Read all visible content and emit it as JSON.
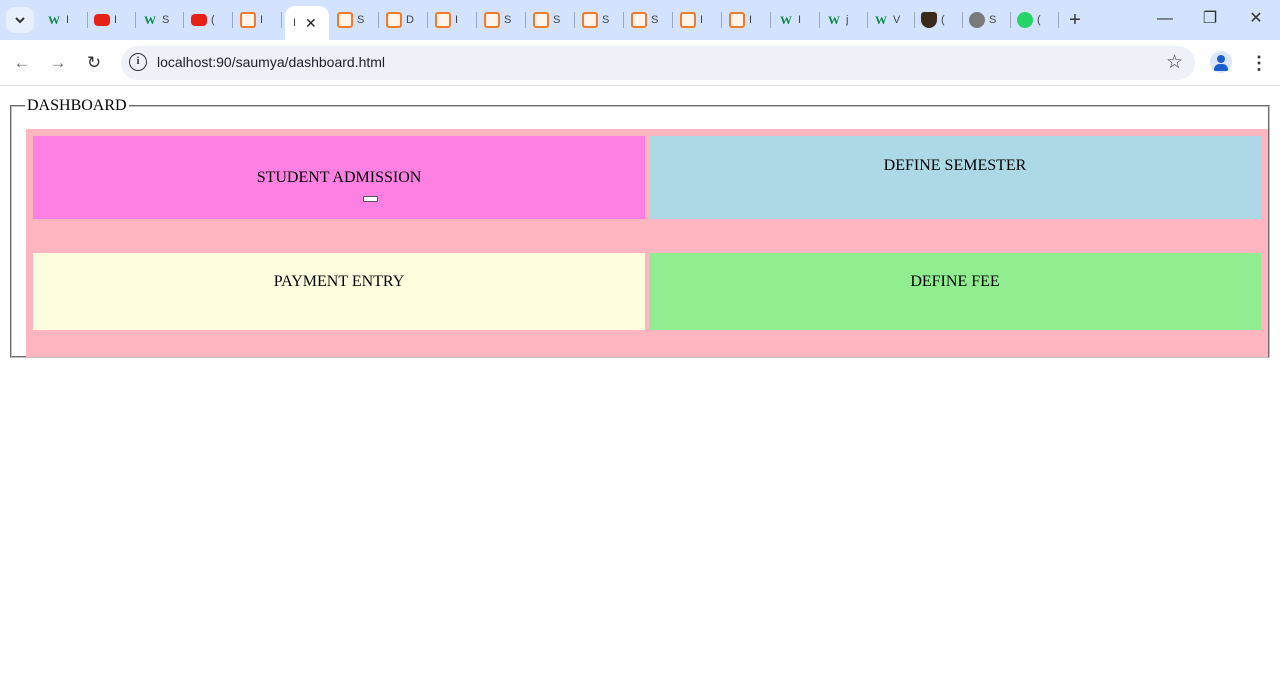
{
  "browser": {
    "tabs": [
      {
        "icon": "w3schools-icon",
        "glyph": "W",
        "title": "I"
      },
      {
        "icon": "youtube-icon",
        "glyph": "",
        "title": "I"
      },
      {
        "icon": "w3schools-icon",
        "glyph": "W",
        "title": "S"
      },
      {
        "icon": "youtube-icon",
        "glyph": "",
        "title": "("
      },
      {
        "icon": "xampp-icon",
        "glyph": "",
        "title": "I"
      },
      {
        "icon": "xampp-icon",
        "glyph": "",
        "title": "S"
      },
      {
        "icon": "xampp-icon",
        "glyph": "",
        "title": "D"
      },
      {
        "icon": "xampp-icon",
        "glyph": "",
        "title": "I"
      },
      {
        "icon": "xampp-icon",
        "glyph": "",
        "title": "S"
      },
      {
        "icon": "xampp-icon",
        "glyph": "",
        "title": "S"
      },
      {
        "icon": "xampp-icon",
        "glyph": "",
        "title": "S"
      },
      {
        "icon": "xampp-icon",
        "glyph": "",
        "title": "S"
      },
      {
        "icon": "xampp-icon",
        "glyph": "",
        "title": "I"
      },
      {
        "icon": "xampp-icon",
        "glyph": "",
        "title": "I"
      },
      {
        "icon": "w3schools-icon",
        "glyph": "W",
        "title": "I"
      },
      {
        "icon": "w3schools-icon",
        "glyph": "W",
        "title": "j"
      },
      {
        "icon": "w3schools-icon",
        "glyph": "W",
        "title": "V"
      },
      {
        "icon": "cup-icon",
        "glyph": "",
        "title": "("
      },
      {
        "icon": "globe-icon",
        "glyph": "",
        "title": "S"
      },
      {
        "icon": "whatsapp-icon",
        "glyph": "",
        "title": "("
      }
    ],
    "active_tab": {
      "title": "I",
      "close": "✕"
    },
    "new_tab": "+",
    "window_controls": {
      "minimize": "—",
      "restore": "❐",
      "close": "✕"
    },
    "nav": {
      "back": "←",
      "forward": "→",
      "reload": "↻"
    },
    "address": {
      "info": "i",
      "url": "localhost:90/saumya/dashboard.html"
    },
    "bookmark": "☆",
    "menu": "⋮"
  },
  "dashboard": {
    "legend": "DASHBOARD",
    "cells": {
      "admission": "STUDENT ADMISSION",
      "semester": "DEFINE SEMESTER",
      "payment": "PAYMENT ENTRY",
      "fee": "DEFINE FEE"
    },
    "colors": {
      "container": "#ffb6c1",
      "admission": "#ff80e3",
      "semester": "#add8e6",
      "payment": "#ffffe0",
      "fee": "#90ee90"
    }
  }
}
